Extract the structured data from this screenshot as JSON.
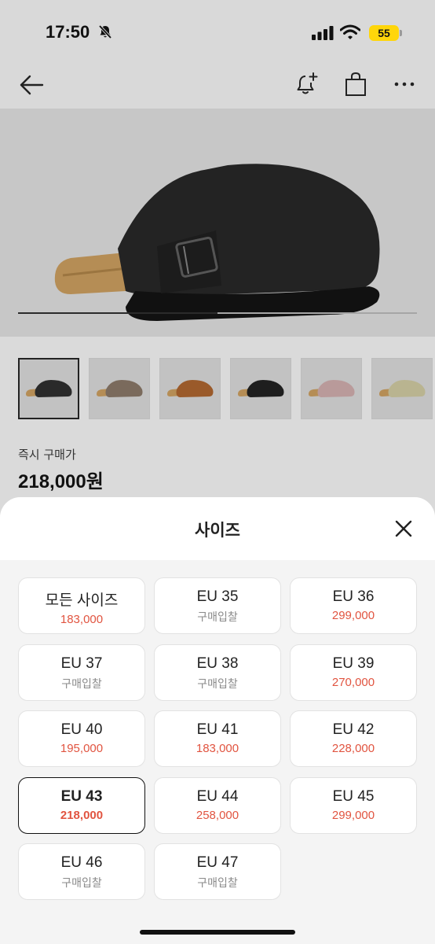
{
  "status_bar": {
    "time": "17:50",
    "battery": "55",
    "icons": [
      "bell-slash-icon",
      "cellular-signal-icon",
      "wifi-icon",
      "battery-icon"
    ]
  },
  "nav": {
    "icons": [
      "back-arrow-icon",
      "alarm-add-icon",
      "shopping-bag-icon",
      "more-icon"
    ]
  },
  "carousel": {
    "progress": 0.5
  },
  "thumbnails": [
    {
      "name": "black",
      "color": "#2a2a2a"
    },
    {
      "name": "taupe",
      "color": "#7a6a5c"
    },
    {
      "name": "mocha",
      "color": "#9a5a2a"
    },
    {
      "name": "black-leather",
      "color": "#1e1e1e"
    },
    {
      "name": "pink",
      "color": "#b99a9a"
    },
    {
      "name": "sand",
      "color": "#b9b490"
    }
  ],
  "price": {
    "label": "즉시 구매가",
    "value": "218,000원"
  },
  "sheet": {
    "title": "사이즈",
    "sizes": [
      {
        "name": "모든 사이즈",
        "price": "183,000",
        "bid": false,
        "selected": false
      },
      {
        "name": "EU 35",
        "price": "구매입찰",
        "bid": true,
        "selected": false
      },
      {
        "name": "EU 36",
        "price": "299,000",
        "bid": false,
        "selected": false
      },
      {
        "name": "EU 37",
        "price": "구매입찰",
        "bid": true,
        "selected": false
      },
      {
        "name": "EU 38",
        "price": "구매입찰",
        "bid": true,
        "selected": false
      },
      {
        "name": "EU 39",
        "price": "270,000",
        "bid": false,
        "selected": false
      },
      {
        "name": "EU 40",
        "price": "195,000",
        "bid": false,
        "selected": false
      },
      {
        "name": "EU 41",
        "price": "183,000",
        "bid": false,
        "selected": false
      },
      {
        "name": "EU 42",
        "price": "228,000",
        "bid": false,
        "selected": false
      },
      {
        "name": "EU 43",
        "price": "218,000",
        "bid": false,
        "selected": true
      },
      {
        "name": "EU 44",
        "price": "258,000",
        "bid": false,
        "selected": false
      },
      {
        "name": "EU 45",
        "price": "299,000",
        "bid": false,
        "selected": false
      },
      {
        "name": "EU 46",
        "price": "구매입찰",
        "bid": true,
        "selected": false
      },
      {
        "name": "EU 47",
        "price": "구매입찰",
        "bid": true,
        "selected": false
      }
    ]
  },
  "colors": {
    "accent_price": "#e15440",
    "bid_text": "#8a8a8a"
  }
}
